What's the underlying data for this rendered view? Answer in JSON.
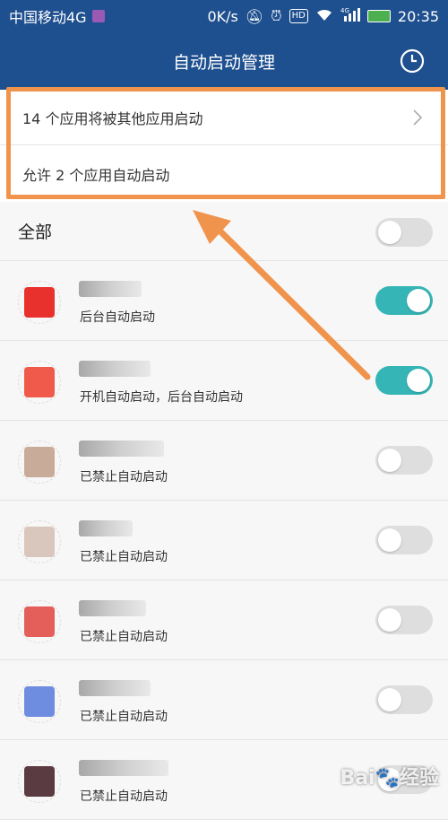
{
  "status_bar": {
    "carrier": "中国移动4G",
    "speed": "0K/s",
    "hd": "HD",
    "network": "4G",
    "time": "20:35"
  },
  "header": {
    "title": "自动启动管理",
    "history_icon": "clock-icon"
  },
  "summary": {
    "launched_by_others": "14 个应用将被其他应用启动",
    "allowed_autostart": "允许 2 个应用自动启动"
  },
  "all_toggle": {
    "label": "全部",
    "on": false
  },
  "apps": [
    {
      "status": "后台自动启动",
      "on": true,
      "avatar_color": "#e8302c",
      "name_width": 70
    },
    {
      "status": "开机自动启动，后台自动启动",
      "on": true,
      "avatar_color": "#ef5a4a",
      "name_width": 80
    },
    {
      "status": "已禁止自动启动",
      "on": false,
      "avatar_color": "#c9ab9a",
      "name_width": 95
    },
    {
      "status": "已禁止自动启动",
      "on": false,
      "avatar_color": "#d9c6bc",
      "name_width": 60
    },
    {
      "status": "已禁止自动启动",
      "on": false,
      "avatar_color": "#e45f5a",
      "name_width": 75
    },
    {
      "status": "已禁止自动启动",
      "on": false,
      "avatar_color": "#6f8de0",
      "name_width": 80
    },
    {
      "status": "已禁止自动启动",
      "on": false,
      "avatar_color": "#5b3b42",
      "name_width": 100
    }
  ],
  "colors": {
    "header_bg": "#1e4f8f",
    "toggle_on": "#35b5b5",
    "annotation": "#f0944d"
  }
}
